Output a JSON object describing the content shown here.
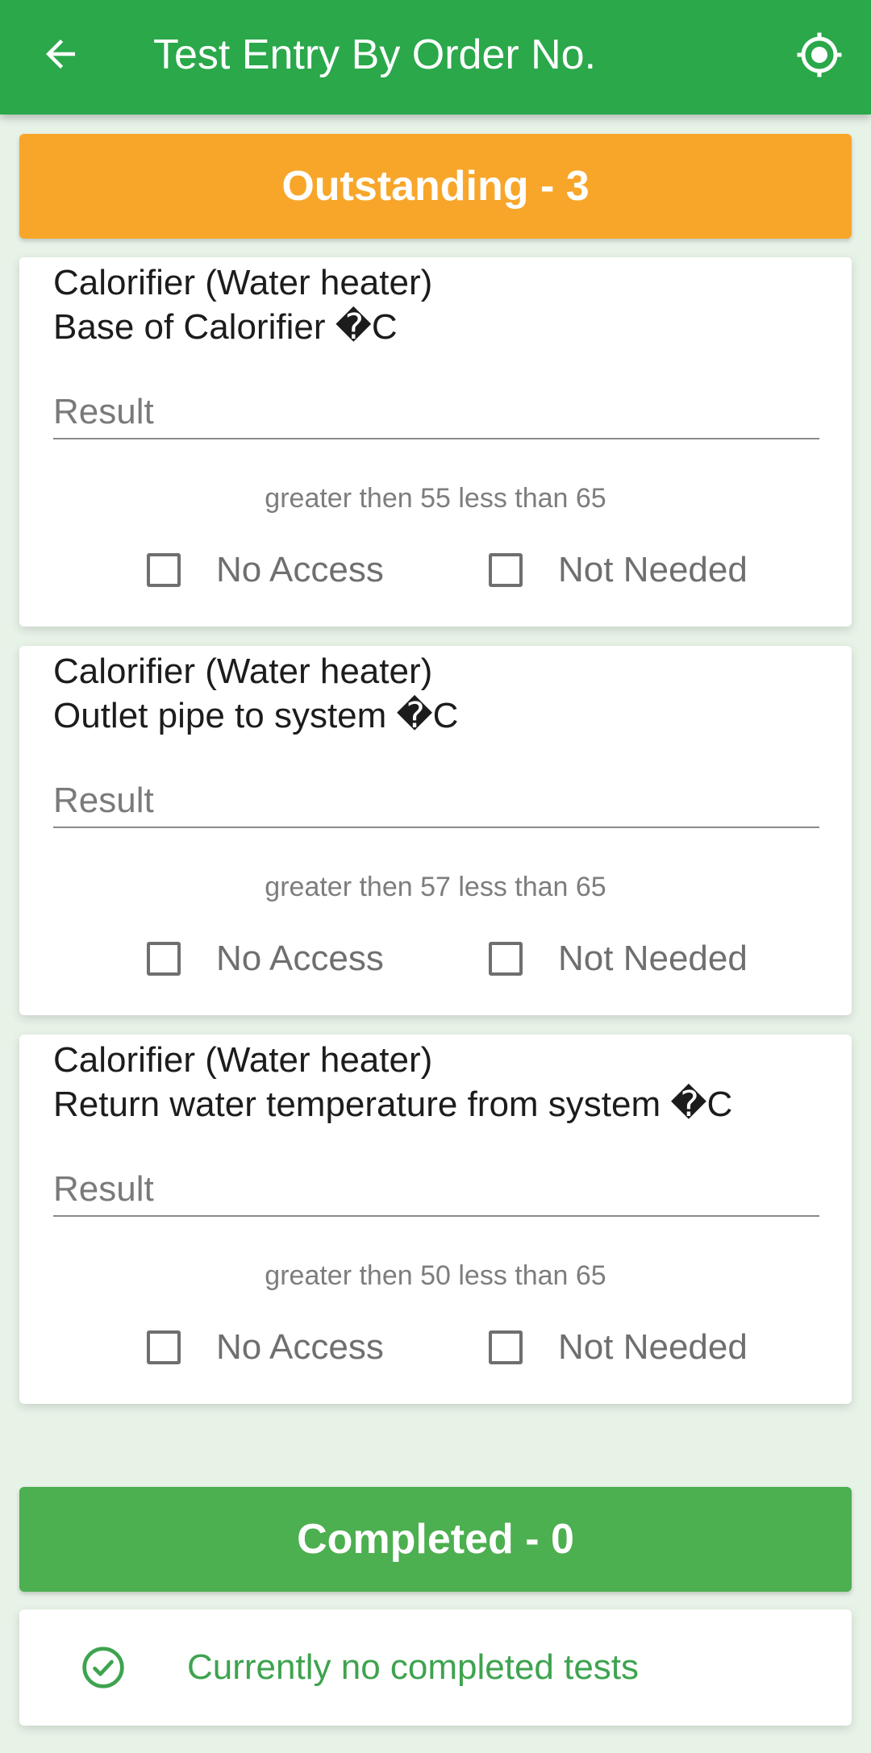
{
  "appbar": {
    "title": "Test Entry By Order No.",
    "back_icon": "arrow-back-icon",
    "location_icon": "gps-fixed-icon",
    "color": "#2aa84a"
  },
  "outstanding": {
    "label": "Outstanding - 3",
    "color": "#f8a62a"
  },
  "tests": [
    {
      "asset": "Calorifier (Water heater)",
      "measurement": "Base of Calorifier �C",
      "result_placeholder": "Result",
      "result_value": "",
      "range": "greater then 55 less than 65",
      "no_access_label": "No Access",
      "no_access_checked": false,
      "not_needed_label": "Not Needed",
      "not_needed_checked": false
    },
    {
      "asset": "Calorifier (Water heater)",
      "measurement": "Outlet pipe to system �C",
      "result_placeholder": "Result",
      "result_value": "",
      "range": "greater then 57 less than 65",
      "no_access_label": "No Access",
      "no_access_checked": false,
      "not_needed_label": "Not Needed",
      "not_needed_checked": false
    },
    {
      "asset": "Calorifier (Water heater)",
      "measurement": "Return water temperature from system �C",
      "result_placeholder": "Result",
      "result_value": "",
      "range": "greater then 50 less than 65",
      "no_access_label": "No Access",
      "no_access_checked": false,
      "not_needed_label": "Not Needed",
      "not_needed_checked": false
    }
  ],
  "completed": {
    "label": "Completed - 0",
    "color": "#4caf50",
    "empty_message": "Currently no completed tests",
    "empty_icon": "check-circle-icon"
  }
}
